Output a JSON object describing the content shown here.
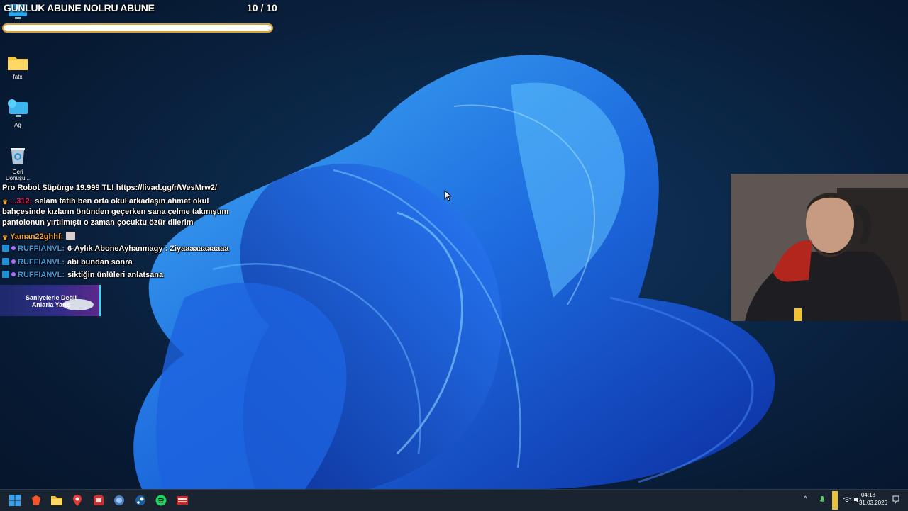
{
  "subscriber_goal": {
    "title": "GUNLUK ABUNE NOLRU ABUNE",
    "count": "10 / 10",
    "progress": 1.0
  },
  "desktop_icons": [
    {
      "label": "fatx",
      "icon": "folder-icon"
    },
    {
      "label": "Ağ",
      "icon": "network-icon"
    },
    {
      "label": "Geri Dönüşü...",
      "icon": "recycle-bin-icon"
    }
  ],
  "chat": {
    "promo": "Pro Robot Süpürge 19.999 TL! https://livad.gg/r/WesMrw2/",
    "messages": [
      {
        "user": "...312:",
        "user_color": "#e0245e",
        "text": "selam fatih ben orta okul arkadaşın ahmet okul",
        "cont1": "bahçesinde kızların önünden geçerken sana çelme takmıştım",
        "cont2": "pantolonun yırtılmıştı o zaman çocuktu özür dilerim"
      },
      {
        "user": "Yaman22ghhf:",
        "user_color": "#f0a43a",
        "text": ""
      },
      {
        "user": "RUFFIANVL:",
        "user_color": "#3b9be0",
        "text": "6-Aylık AboneAyhanmagy : Ziyaaaaaaaaaaa"
      },
      {
        "user": "RUFFIANVL:",
        "user_color": "#3b9be0",
        "text": "abi bundan sonra"
      },
      {
        "user": "RUFFIANVL:",
        "user_color": "#3b9be0",
        "text": "siktiğin ünlüleri anlatsana"
      }
    ]
  },
  "ad_banner": {
    "text_line1": "Saniyelerle Değil",
    "text_line2": "Anlarla Yarış"
  },
  "taskbar": {
    "apps": [
      "start-icon",
      "brave-icon",
      "file-explorer-icon",
      "maps-icon",
      "red-app-icon",
      "globe-app-icon",
      "steam-icon",
      "spotify-icon",
      "multi-app-icon"
    ],
    "time": "04:18",
    "date": "31.03.2026"
  },
  "colors": {
    "accent": "#1f8fd6",
    "goal_border": "#d9a233",
    "taskbar": "#1a2430"
  }
}
